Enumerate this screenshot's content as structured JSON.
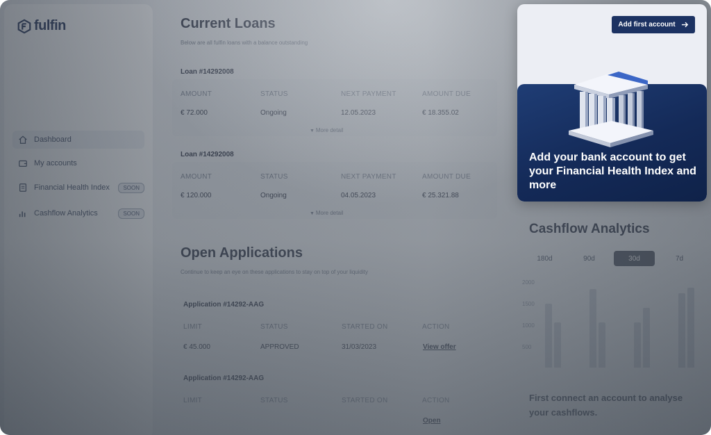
{
  "brand": {
    "name": "fulfin"
  },
  "sidebar": {
    "items": [
      {
        "label": "Dashboard",
        "icon": "home-icon",
        "badge": ""
      },
      {
        "label": "My accounts",
        "icon": "wallet-icon",
        "badge": ""
      },
      {
        "label": "Financial Health Index",
        "icon": "document-icon",
        "badge": "SOON"
      },
      {
        "label": "Cashflow Analytics",
        "icon": "chart-icon",
        "badge": "SOON"
      }
    ]
  },
  "current_loans": {
    "title": "Current Loans",
    "subtitle": "Below are all fulfin loans with a balance outstanding",
    "headers": [
      "AMOUNT",
      "STATUS",
      "NEXT PAYMENT",
      "AMOUNT DUE"
    ],
    "more_label": "More detail",
    "loans": [
      {
        "label": "Loan #14292008",
        "amount": "€ 72.000",
        "status": "Ongoing",
        "next_payment": "12.05.2023",
        "amount_due": "€ 18.355.02"
      },
      {
        "label": "Loan #14292008",
        "amount": "€ 120.000",
        "status": "Ongoing",
        "next_payment": "04.05.2023",
        "amount_due": "€ 25.321.88"
      }
    ]
  },
  "open_applications": {
    "title": "Open Applications",
    "subtitle": "Continue to keep an eye on these applications to stay on top of your liquidity",
    "headers": [
      "LIMIT",
      "STATUS",
      "STARTED ON",
      "ACTION"
    ],
    "applications": [
      {
        "label": "Application #14292-AAG",
        "limit": "€ 45.000",
        "status": "APPROVED",
        "started_on": "31/03/2023",
        "action": "View offer"
      },
      {
        "label": "Application #14292-AAG",
        "limit": "",
        "status": "",
        "started_on": "",
        "action": "Open"
      }
    ]
  },
  "popover": {
    "button_label": "Add first account",
    "message": "Add your bank account to get your Financial Health Index and more",
    "illustration": "bank-building-icon"
  },
  "cashflow": {
    "title": "Cashflow Analytics",
    "periods": [
      "180d",
      "90d",
      "30d",
      "7d"
    ],
    "selected_period": "30d",
    "y_labels": [
      "2000",
      "1500",
      "1000",
      "500"
    ],
    "note": "First connect an account to analyse your cashflows."
  },
  "colors": {
    "brand_navy": "#1c3262",
    "overlay": "#4e5662",
    "accent_blue": "#1f3d75"
  }
}
